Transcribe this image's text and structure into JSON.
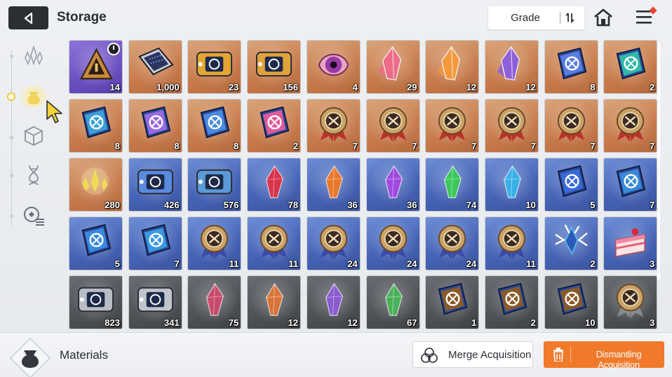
{
  "header": {
    "title": "Storage",
    "sort_label": "Grade"
  },
  "sidebar": {
    "tabs": [
      {
        "icon": "crystal-cluster-icon",
        "active": false
      },
      {
        "icon": "material-bag-icon",
        "active": true
      },
      {
        "icon": "cube-icon",
        "active": false
      },
      {
        "icon": "dna-helix-icon",
        "active": false
      },
      {
        "icon": "gear-list-icon",
        "active": false
      }
    ]
  },
  "items": [
    {
      "name": "timed-ticket",
      "bg": "purple",
      "qty": "14",
      "art": "triangle",
      "color": "#c98a3a",
      "timer": true
    },
    {
      "name": "data-chip",
      "bg": "orange",
      "qty": "1,000",
      "art": "chip",
      "color": "#2c3560"
    },
    {
      "name": "hourglass-ticket-gold",
      "bg": "orange",
      "qty": "23",
      "art": "ticket",
      "color": "#e3a634"
    },
    {
      "name": "compass-ticket-gold",
      "bg": "orange",
      "qty": "156",
      "art": "ticket",
      "color": "#e0a23a"
    },
    {
      "name": "eye-core",
      "bg": "orange",
      "qty": "4",
      "art": "eye",
      "color": "#9a3aa8"
    },
    {
      "name": "pink-crystal",
      "bg": "orange",
      "qty": "29",
      "art": "crystal",
      "color": "#ef6a8a"
    },
    {
      "name": "amber-crystal",
      "bg": "orange",
      "qty": "12",
      "art": "crystal",
      "color": "#f59a3a"
    },
    {
      "name": "violet-crystal",
      "bg": "orange",
      "qty": "12",
      "art": "crystal",
      "color": "#8a5de0"
    },
    {
      "name": "sword-book",
      "bg": "orange",
      "qty": "8",
      "art": "book",
      "color": "#5a7de0"
    },
    {
      "name": "shield-book",
      "bg": "orange",
      "qty": "2",
      "art": "book",
      "color": "#2fb8a8"
    },
    {
      "name": "eye-book",
      "bg": "orange",
      "qty": "8",
      "art": "book",
      "color": "#3aa0d8"
    },
    {
      "name": "cross-book",
      "bg": "orange",
      "qty": "8",
      "art": "book",
      "color": "#9a6ae0"
    },
    {
      "name": "rune-book",
      "bg": "orange",
      "qty": "8",
      "art": "book",
      "color": "#4a8ae0"
    },
    {
      "name": "orb-book",
      "bg": "orange",
      "qty": "2",
      "art": "book",
      "color": "#e05a9a"
    },
    {
      "name": "sword-medal-red",
      "bg": "orange",
      "qty": "7",
      "art": "medal",
      "color": "#b8322a"
    },
    {
      "name": "shield-medal-red",
      "bg": "orange",
      "qty": "7",
      "art": "medal",
      "color": "#b8322a"
    },
    {
      "name": "eye-medal-red",
      "bg": "orange",
      "qty": "7",
      "art": "medal",
      "color": "#b8322a"
    },
    {
      "name": "cross-medal-red",
      "bg": "orange",
      "qty": "7",
      "art": "medal",
      "color": "#b8322a"
    },
    {
      "name": "compass-medal-red",
      "bg": "orange",
      "qty": "7",
      "art": "medal",
      "color": "#b8322a"
    },
    {
      "name": "target-medal-red",
      "bg": "orange",
      "qty": "7",
      "art": "medal",
      "color": "#b8322a"
    },
    {
      "name": "gold-shards",
      "bg": "orange",
      "qty": "280",
      "art": "shards",
      "color": "#e8d23a"
    },
    {
      "name": "hourglass-ticket-blue",
      "bg": "blue",
      "qty": "426",
      "art": "ticket",
      "color": "#5a8ae0"
    },
    {
      "name": "compass-ticket-blue",
      "bg": "blue",
      "qty": "576",
      "art": "ticket",
      "color": "#5a9ad8"
    },
    {
      "name": "red-gem",
      "bg": "blue",
      "qty": "78",
      "art": "gem",
      "color": "#d8344a"
    },
    {
      "name": "orange-gem",
      "bg": "blue",
      "qty": "36",
      "art": "gem",
      "color": "#e8782a"
    },
    {
      "name": "violet-gem",
      "bg": "blue",
      "qty": "36",
      "art": "gem",
      "color": "#a04ae0"
    },
    {
      "name": "green-gem",
      "bg": "blue",
      "qty": "74",
      "art": "gem",
      "color": "#3ac85a"
    },
    {
      "name": "cyan-gem",
      "bg": "blue",
      "qty": "10",
      "art": "gem",
      "color": "#3ab0e8"
    },
    {
      "name": "sword-book-blue",
      "bg": "blue",
      "qty": "5",
      "art": "book",
      "color": "#3a6ad8"
    },
    {
      "name": "wing-book-blue",
      "bg": "blue",
      "qty": "7",
      "art": "book",
      "color": "#3a8ad8"
    },
    {
      "name": "rune-book-blue",
      "bg": "blue",
      "qty": "5",
      "art": "book",
      "color": "#3a8ae0"
    },
    {
      "name": "orb-book-blue",
      "bg": "blue",
      "qty": "7",
      "art": "book",
      "color": "#3a9ae0"
    },
    {
      "name": "sword-medal-silver",
      "bg": "blue",
      "qty": "11",
      "art": "medal",
      "color": "#3a4aa8"
    },
    {
      "name": "shield-medal-silver",
      "bg": "blue",
      "qty": "11",
      "art": "medal",
      "color": "#3a4aa8"
    },
    {
      "name": "eye-medal-silver",
      "bg": "blue",
      "qty": "24",
      "art": "medal",
      "color": "#3a4aa8"
    },
    {
      "name": "cross-medal-silver",
      "bg": "blue",
      "qty": "24",
      "art": "medal",
      "color": "#3a4aa8"
    },
    {
      "name": "compass-medal-silver",
      "bg": "blue",
      "qty": "24",
      "art": "medal",
      "color": "#3a4aa8"
    },
    {
      "name": "target-medal-silver",
      "bg": "blue",
      "qty": "11",
      "art": "medal",
      "color": "#3a4aa8"
    },
    {
      "name": "ice-crystal-burst",
      "bg": "blue",
      "qty": "2",
      "art": "burst",
      "color": "#5ab0f0"
    },
    {
      "name": "strawberry-cake",
      "bg": "blue",
      "qty": "3",
      "art": "cake",
      "color": "#f08aa0"
    },
    {
      "name": "hourglass-ticket-gray",
      "bg": "gray",
      "qty": "823",
      "art": "ticket",
      "color": "#b8bcc4"
    },
    {
      "name": "compass-ticket-gray",
      "bg": "gray",
      "qty": "341",
      "art": "ticket",
      "color": "#c0c4cc"
    },
    {
      "name": "red-shard-gray",
      "bg": "gray",
      "qty": "75",
      "art": "gem",
      "color": "#c84a6a"
    },
    {
      "name": "orange-shard-gray",
      "bg": "gray",
      "qty": "12",
      "art": "gem",
      "color": "#d8743a"
    },
    {
      "name": "violet-shard-gray",
      "bg": "gray",
      "qty": "12",
      "art": "gem",
      "color": "#8a5ad0"
    },
    {
      "name": "green-shard-gray",
      "bg": "gray",
      "qty": "67",
      "art": "gem",
      "color": "#4ab05a"
    },
    {
      "name": "shield-book-brown",
      "bg": "gray",
      "qty": "1",
      "art": "book",
      "color": "#8a5a2a"
    },
    {
      "name": "eye-book-brown",
      "bg": "gray",
      "qty": "2",
      "art": "book",
      "color": "#8a5a2a"
    },
    {
      "name": "sword-book-brown",
      "bg": "gray",
      "qty": "10",
      "art": "book",
      "color": "#8a5a2a"
    },
    {
      "name": "target-medal-bronze",
      "bg": "gray",
      "qty": "3",
      "art": "medal",
      "color": "#8a8c90"
    }
  ],
  "footer": {
    "category_label": "Materials",
    "merge_label": "Merge Acquisition",
    "dismantle_label": "Dismantling Acquisition"
  },
  "colors": {
    "accent": "#f07a2a",
    "dark": "#2b2e33",
    "notify": "#e8432e"
  }
}
